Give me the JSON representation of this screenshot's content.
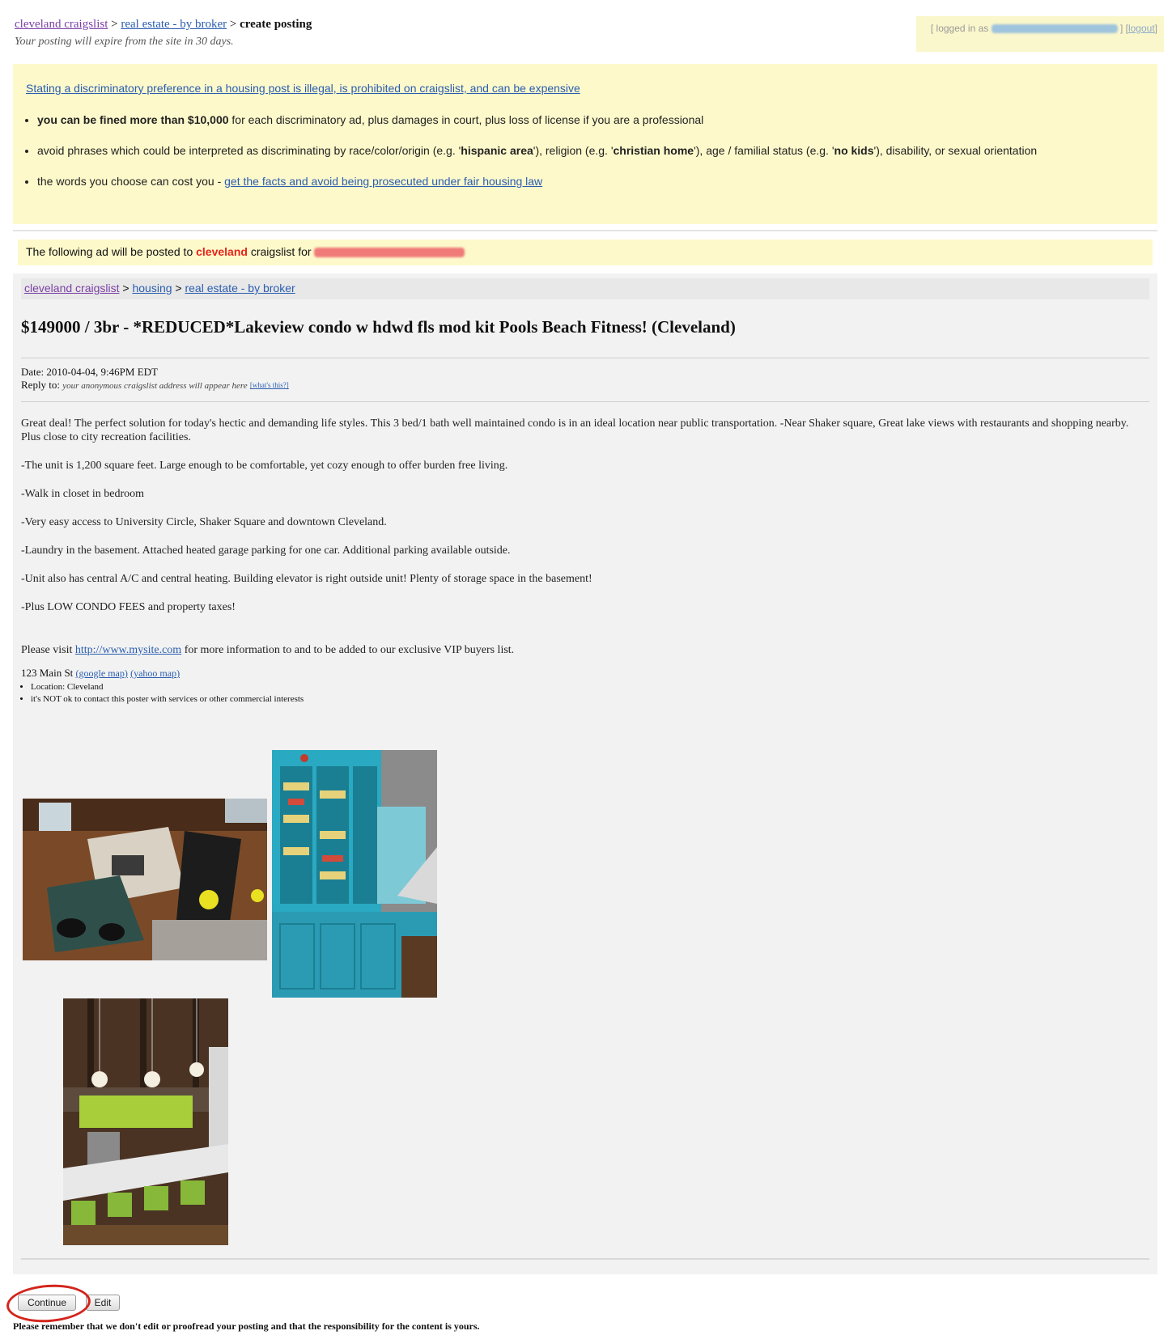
{
  "header": {
    "breadcrumb": [
      {
        "label": "cleveland craigslist",
        "link": true
      },
      {
        "label": "real estate - by broker",
        "link": true
      },
      {
        "label": "create posting",
        "link": false
      }
    ],
    "expiry_note": "Your posting will expire from the site in 30 days.",
    "login_prefix": "[ logged in as",
    "logout_label": "logout"
  },
  "warning": {
    "headline": "Stating a discriminatory preference in a housing post is illegal, is prohibited on craigslist, and can be expensive",
    "bullet1_bold": "you can be fined more than $10,000",
    "bullet1_rest": " for each discriminatory ad, plus damages in court, plus loss of license if you are a professional",
    "bullet2_a": "avoid phrases which could be interpreted as discriminating by race/color/origin (e.g. '",
    "bullet2_b1": "hispanic area",
    "bullet2_c": "'), religion (e.g. '",
    "bullet2_b2": "christian home",
    "bullet2_d": "'), age / familial status (e.g. '",
    "bullet2_b3": "no kids",
    "bullet2_e": "'), disability, or sexual orientation",
    "bullet3_text": "the words you choose can cost you - ",
    "bullet3_link": "get the facts and avoid being prosecuted under fair housing law"
  },
  "notice": {
    "prefix": "The following ad will be posted to ",
    "city": "cleveland",
    "suffix": " craigslist for "
  },
  "preview": {
    "breadcrumb": [
      "cleveland craigslist",
      "housing",
      "real estate - by broker"
    ],
    "title": "$149000 / 3br - *REDUCED*Lakeview condo w hdwd fls mod kit Pools Beach Fitness! (Cleveland)",
    "date": "Date: 2010-04-04, 9:46PM EDT",
    "reply_label": "Reply to: ",
    "reply_anon": "your anonymous craigslist address will appear here",
    "reply_what": "[what's this?]",
    "paragraphs": [
      "Great deal! The perfect solution for today's hectic and demanding life styles. This 3 bed/1 bath well maintained condo is in an ideal location near public transportation. -Near Shaker square, Great lake views with restaurants and shopping nearby. Plus close to city recreation facilities.",
      "-The unit is 1,200 square feet. Large enough to be comfortable, yet cozy enough to offer burden free living.",
      "-Walk in closet in bedroom",
      "-Very easy access to University Circle, Shaker Square and downtown Cleveland.",
      "-Laundry in the basement. Attached heated garage parking for one car. Additional parking available outside.",
      "-Unit also has central A/C and central heating. Building elevator is right outside unit! Plenty of storage space in the basement!",
      "-Plus LOW CONDO FEES and property taxes!"
    ],
    "visit_prefix": "Please visit ",
    "visit_link": "http://www.mysite.com",
    "visit_suffix": " for more information to and to be added to our exclusive VIP buyers list.",
    "address": "123 Main St ",
    "google_map": "(google map)",
    "yahoo_map": "(yahoo map)",
    "facts": [
      "Location: Cleveland",
      "it's NOT ok to contact this poster with services or other commercial interests"
    ]
  },
  "buttons": {
    "continue": "Continue",
    "edit": "Edit"
  },
  "disclaimer": "Please remember that we don't edit or proofread your posting and that the responsibility for the content is yours.",
  "colors": {
    "warning_bg": "#fdf9cb",
    "link": "#2a5db0",
    "city_red": "#e5241b",
    "highlight_circle": "#d3251c"
  }
}
